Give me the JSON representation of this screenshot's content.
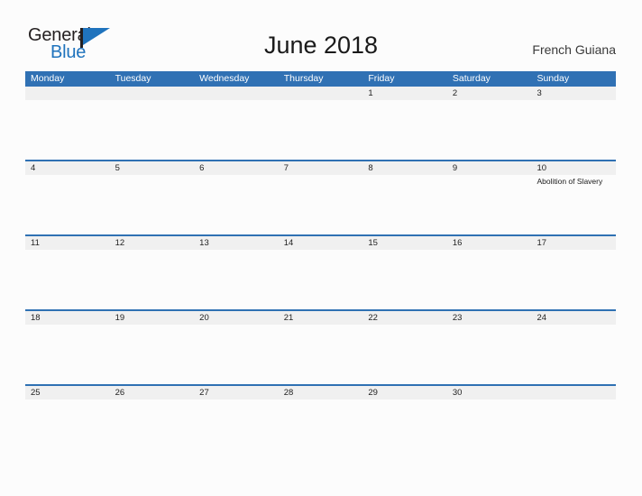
{
  "logo": {
    "word_one": "General",
    "word_two": "Blue",
    "flag_icon": "flag-triangle-icon"
  },
  "header": {
    "title": "June 2018",
    "country": "French Guiana"
  },
  "colors": {
    "header_blue": "#3071b4",
    "separator_blue": "#2f71b3",
    "date_band_gray": "#f0f0f0",
    "page_background": "#fcfcfc",
    "logo_blue": "#1f73bd",
    "logo_dark": "#231f20"
  },
  "calendar": {
    "weekdays": [
      "Monday",
      "Tuesday",
      "Wednesday",
      "Thursday",
      "Friday",
      "Saturday",
      "Sunday"
    ],
    "weeks": [
      {
        "days": [
          {
            "num": "",
            "event": ""
          },
          {
            "num": "",
            "event": ""
          },
          {
            "num": "",
            "event": ""
          },
          {
            "num": "",
            "event": ""
          },
          {
            "num": "1",
            "event": ""
          },
          {
            "num": "2",
            "event": ""
          },
          {
            "num": "3",
            "event": ""
          }
        ]
      },
      {
        "days": [
          {
            "num": "4",
            "event": ""
          },
          {
            "num": "5",
            "event": ""
          },
          {
            "num": "6",
            "event": ""
          },
          {
            "num": "7",
            "event": ""
          },
          {
            "num": "8",
            "event": ""
          },
          {
            "num": "9",
            "event": ""
          },
          {
            "num": "10",
            "event": "Abolition of Slavery"
          }
        ]
      },
      {
        "days": [
          {
            "num": "11",
            "event": ""
          },
          {
            "num": "12",
            "event": ""
          },
          {
            "num": "13",
            "event": ""
          },
          {
            "num": "14",
            "event": ""
          },
          {
            "num": "15",
            "event": ""
          },
          {
            "num": "16",
            "event": ""
          },
          {
            "num": "17",
            "event": ""
          }
        ]
      },
      {
        "days": [
          {
            "num": "18",
            "event": ""
          },
          {
            "num": "19",
            "event": ""
          },
          {
            "num": "20",
            "event": ""
          },
          {
            "num": "21",
            "event": ""
          },
          {
            "num": "22",
            "event": ""
          },
          {
            "num": "23",
            "event": ""
          },
          {
            "num": "24",
            "event": ""
          }
        ]
      },
      {
        "days": [
          {
            "num": "25",
            "event": ""
          },
          {
            "num": "26",
            "event": ""
          },
          {
            "num": "27",
            "event": ""
          },
          {
            "num": "28",
            "event": ""
          },
          {
            "num": "29",
            "event": ""
          },
          {
            "num": "30",
            "event": ""
          },
          {
            "num": "",
            "event": ""
          }
        ]
      }
    ]
  }
}
